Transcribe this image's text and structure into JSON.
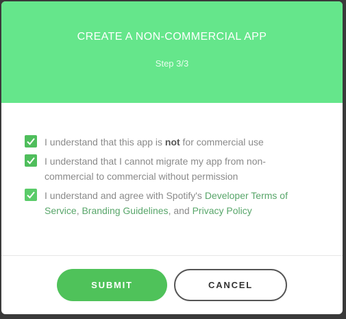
{
  "header": {
    "title": "CREATE A NON-COMMERCIAL APP",
    "step": "Step 3/3"
  },
  "checkboxes": [
    {
      "checked": true,
      "prefix": "I understand that this app is ",
      "bold": "not",
      "suffix": " for commercial use"
    },
    {
      "checked": true,
      "text_line1": "I understand that I cannot migrate my app from non-",
      "text_line2": "commercial to commercial without permission"
    },
    {
      "checked": true,
      "prefix": "I understand and agree with Spotify's ",
      "link_terms": "Developer Terms of Service",
      "sep": ", ",
      "link_branding": "Branding Guidelines",
      "and": ", and ",
      "link_privacy": "Privacy Policy"
    }
  ],
  "footer": {
    "submit_label": "SUBMIT",
    "cancel_label": "CANCEL"
  },
  "colors": {
    "header_bg": "#65e68b",
    "accent": "#4fc25a",
    "link": "#58a66a"
  }
}
